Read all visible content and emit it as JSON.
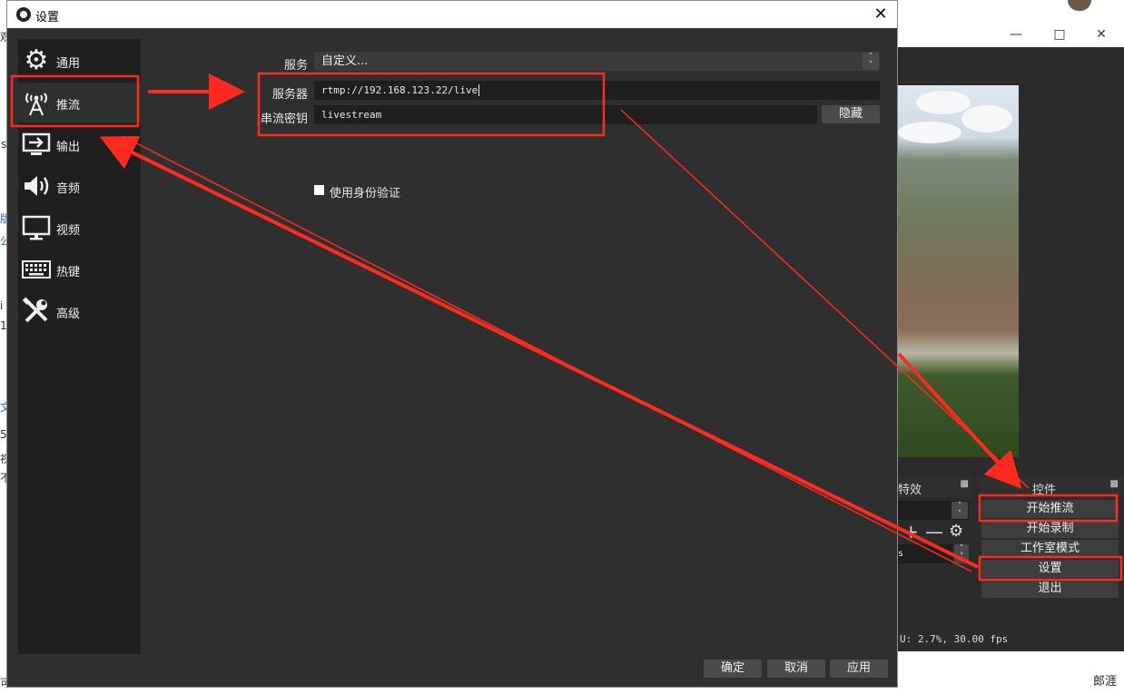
{
  "dialog": {
    "title": "设置",
    "sidebar": [
      {
        "label": "通用",
        "icon": "gear-icon"
      },
      {
        "label": "推流",
        "icon": "antenna-icon"
      },
      {
        "label": "输出",
        "icon": "output-icon"
      },
      {
        "label": "音频",
        "icon": "speaker-icon"
      },
      {
        "label": "视频",
        "icon": "monitor-icon"
      },
      {
        "label": "热键",
        "icon": "keyboard-icon"
      },
      {
        "label": "高级",
        "icon": "tools-icon"
      }
    ],
    "active_section": "推流",
    "service": {
      "label": "服务",
      "value": "自定义..."
    },
    "server": {
      "label": "服务器",
      "value": "rtmp://192.168.123.22/live"
    },
    "stream_key": {
      "label": "串流密钥",
      "value": "livestream",
      "toggle": "隐藏"
    },
    "use_auth": {
      "label": "使用身份验证",
      "checked": false
    },
    "buttons": {
      "ok": "确定",
      "cancel": "取消",
      "apply": "应用"
    }
  },
  "main_window": {
    "effects_header": "特效",
    "controls_header": "控件",
    "controls": [
      "开始推流",
      "开始录制",
      "工作室模式",
      "设置",
      "退出"
    ],
    "status": "U: 2.7%, 30.00 fps",
    "scene_item": "s"
  },
  "background": {
    "corner_name": "郎涯",
    "snippets": [
      "观",
      "s",
      "版",
      "公",
      "i",
      "1",
      "文",
      "5",
      "视",
      "不",
      "可"
    ]
  },
  "colors": {
    "annotation": "#ff2a1f",
    "dialog_bg": "#2f2f2f",
    "sidebar_bg": "#1f1f1f"
  }
}
